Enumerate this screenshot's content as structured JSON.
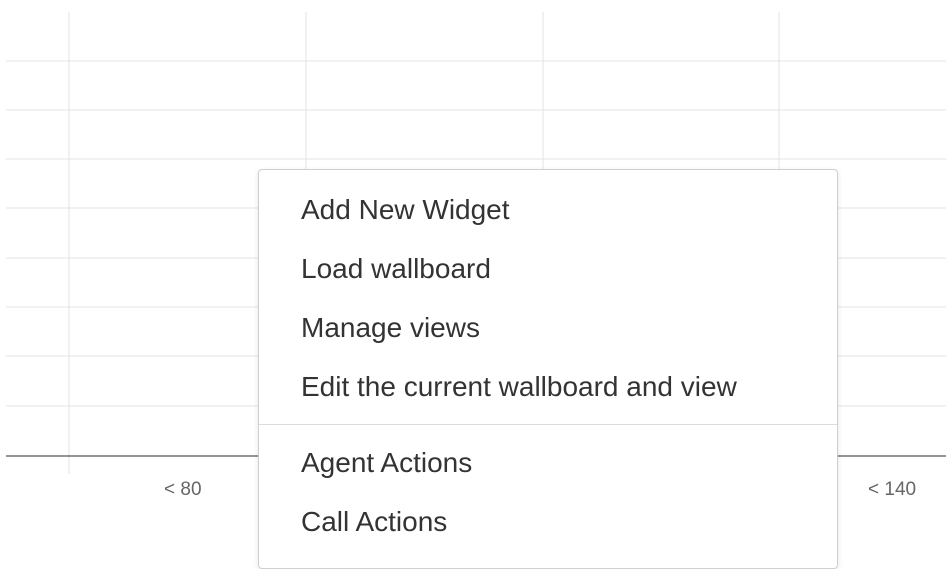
{
  "chart": {
    "x_ticks": [
      "< 80",
      "< 140"
    ]
  },
  "menu": {
    "items": [
      {
        "label": "Add New Widget"
      },
      {
        "label": "Load wallboard"
      },
      {
        "label": "Manage views"
      },
      {
        "label": "Edit the current wallboard and view"
      }
    ],
    "secondary_items": [
      {
        "label": "Agent Actions"
      },
      {
        "label": "Call Actions"
      }
    ]
  }
}
